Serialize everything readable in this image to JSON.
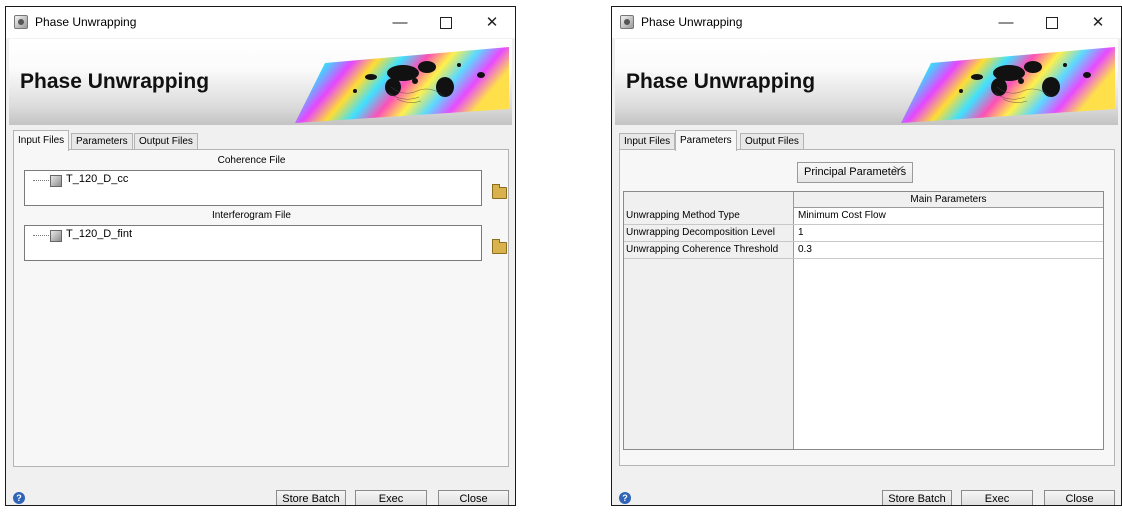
{
  "windows": [
    {
      "title": "Phase Unwrapping",
      "banner_title": "Phase Unwrapping",
      "tabs": [
        "Input Files",
        "Parameters",
        "Output Files"
      ],
      "active_tab": "Input Files",
      "input_files": {
        "coherence_label": "Coherence File",
        "coherence_file": "T_120_D_cc",
        "interferogram_label": "Interferogram File",
        "interferogram_file": "T_120_D_fint"
      },
      "buttons": {
        "store_batch": "Store Batch",
        "exec": "Exec",
        "close": "Close"
      }
    },
    {
      "title": "Phase Unwrapping",
      "banner_title": "Phase Unwrapping",
      "tabs": [
        "Input Files",
        "Parameters",
        "Output Files"
      ],
      "active_tab": "Parameters",
      "parameters": {
        "dropdown_selected": "Principal Parameters",
        "table_header": "Main Parameters",
        "rows": [
          {
            "label": "Unwrapping Method Type",
            "value": "Minimum Cost Flow"
          },
          {
            "label": "Unwrapping Decomposition Level",
            "value": "1"
          },
          {
            "label": "Unwrapping Coherence Threshold",
            "value": "0.3"
          }
        ]
      },
      "buttons": {
        "store_batch": "Store Batch",
        "exec": "Exec",
        "close": "Close"
      }
    }
  ],
  "icons": {
    "app": "app-icon",
    "minimize": "minimize-icon",
    "maximize": "maximize-icon",
    "close": "close-icon",
    "folder": "folder-icon",
    "file": "raster-file-icon",
    "help": "help-icon",
    "dropdown": "chevron-down-icon"
  },
  "glyphs": {
    "minimize": "—",
    "close": "✕",
    "help": "?",
    "chevron": "﹀"
  },
  "colors": {
    "help_blue": "#2f64b8",
    "folder": "#d9b24e",
    "banner_gray": "#c3c3c3"
  }
}
